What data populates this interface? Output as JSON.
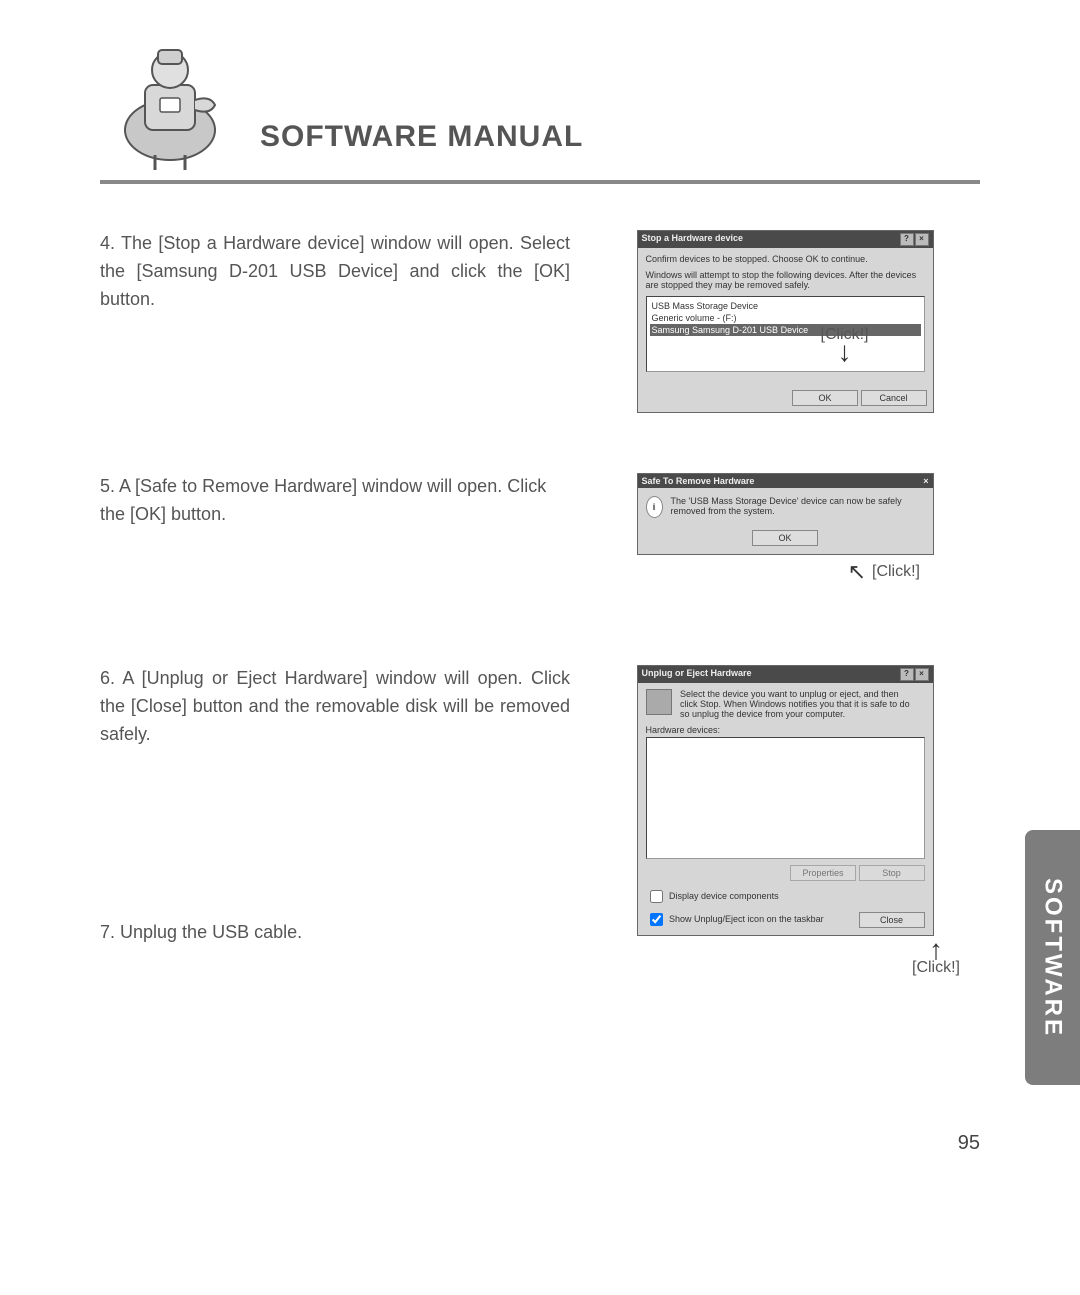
{
  "header": {
    "title": "SOFTWARE MANUAL"
  },
  "steps": {
    "s4": "4. The [Stop a Hardware device] window will open. Select the [Samsung D-201 USB Device] and click the [OK] button.",
    "s5": "5. A [Safe to Remove Hardware] window will open. Click the [OK] button.",
    "s6": "6. A [Unplug or Eject Hardware] window will open. Click the [Close] button and the removable disk will be removed safely.",
    "s7": "7. Unplug the USB cable."
  },
  "click_labels": {
    "c1": "[Click!]",
    "c2": "[Click!]",
    "c3": "[Click!]"
  },
  "dlg1": {
    "title": "Stop a Hardware device",
    "line1": "Confirm devices to be stopped. Choose OK to continue.",
    "line2": "Windows will attempt to stop the following devices. After the devices are stopped they may be removed safely.",
    "item1": "USB Mass Storage Device",
    "item2": "Generic volume - (F:)",
    "item3": "Samsung Samsung D-201 USB Device",
    "ok": "OK",
    "cancel": "Cancel"
  },
  "dlg2": {
    "title": "Safe To Remove Hardware",
    "msg": "The 'USB Mass Storage Device' device can now be safely removed from the system.",
    "ok": "OK"
  },
  "dlg3": {
    "title": "Unplug or Eject Hardware",
    "instr": "Select the device you want to unplug or eject, and then click Stop. When Windows notifies you that it is safe to do so unplug the device from your computer.",
    "label": "Hardware devices:",
    "properties": "Properties",
    "stop": "Stop",
    "chk1": "Display device components",
    "chk2": "Show Unplug/Eject icon on the taskbar",
    "close": "Close"
  },
  "side_tab": "SOFTWARE",
  "page_number": "95"
}
